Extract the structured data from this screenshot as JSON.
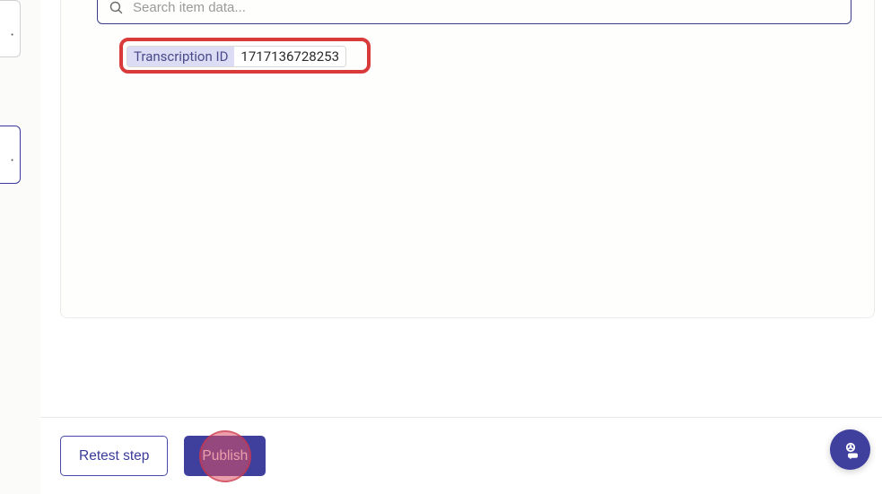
{
  "search": {
    "placeholder": "Search item data..."
  },
  "tag": {
    "label": "Transcription ID",
    "value": "1717136728253"
  },
  "footer": {
    "retest_label": "Retest step",
    "publish_label": "Publish"
  }
}
